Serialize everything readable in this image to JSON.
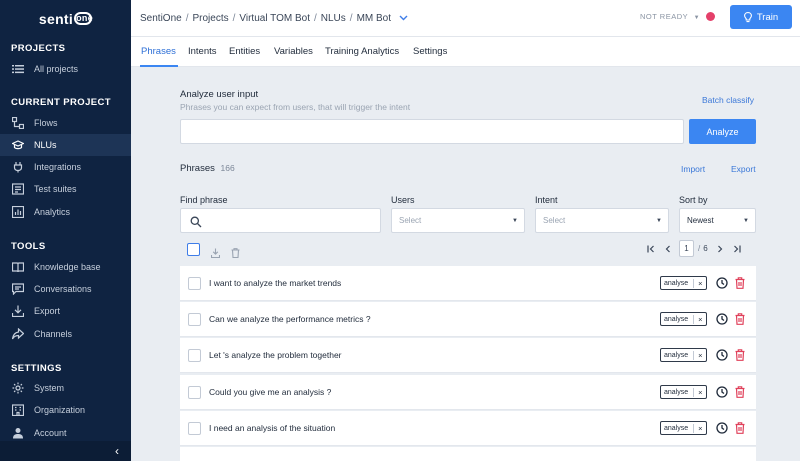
{
  "brand": {
    "name": "senti",
    "bubble": "one"
  },
  "sidebar": {
    "sections": [
      {
        "title": "PROJECTS"
      },
      {
        "title": "CURRENT PROJECT"
      },
      {
        "title": "TOOLS"
      },
      {
        "title": "SETTINGS"
      }
    ],
    "items": [
      {
        "label": "All projects",
        "icon": "list-icon"
      },
      {
        "label": "Flows",
        "icon": "flows-icon"
      },
      {
        "label": "NLUs",
        "icon": "graduation-cap-icon"
      },
      {
        "label": "Integrations",
        "icon": "plug-icon"
      },
      {
        "label": "Test suites",
        "icon": "test-suites-icon"
      },
      {
        "label": "Analytics",
        "icon": "bar-chart-icon"
      },
      {
        "label": "Knowledge base",
        "icon": "book-icon"
      },
      {
        "label": "Conversations",
        "icon": "chat-icon"
      },
      {
        "label": "Export",
        "icon": "download-icon"
      },
      {
        "label": "Channels",
        "icon": "share-icon"
      },
      {
        "label": "System",
        "icon": "gear-icon"
      },
      {
        "label": "Organization",
        "icon": "building-icon"
      },
      {
        "label": "Account",
        "icon": "user-icon"
      }
    ],
    "collapse_glyph": "‹"
  },
  "topbar": {
    "breadcrumb": [
      "SentiOne",
      "Projects",
      "Virtual TOM Bot",
      "NLUs",
      "MM Bot"
    ],
    "separator": "/",
    "status": "NOT READY",
    "train_label": "Train"
  },
  "tabs": [
    "Phrases",
    "Intents",
    "Entities",
    "Variables",
    "Training Analytics",
    "Settings"
  ],
  "analyze": {
    "title": "Analyze user input",
    "subtitle": "Phrases you can expect from users, that will trigger the intent",
    "batch_label": "Batch classify",
    "input_value": "",
    "button_label": "Analyze"
  },
  "phrases": {
    "title": "Phrases",
    "count": "166",
    "import_label": "Import",
    "export_label": "Export"
  },
  "filters": {
    "find_label": "Find phrase",
    "find_value": "",
    "users_label": "Users",
    "users_placeholder": "Select",
    "intent_label": "Intent",
    "intent_placeholder": "Select",
    "sort_label": "Sort by",
    "sort_value": "Newest"
  },
  "pagination": {
    "current": "1",
    "separator": "/",
    "total": "6"
  },
  "rows": [
    {
      "text": "I want to analyze the market trends",
      "tag": "analyse"
    },
    {
      "text": "Can we analyze the performance metrics ?",
      "tag": "analyse"
    },
    {
      "text": "Let 's analyze the problem together",
      "tag": "analyse"
    },
    {
      "text": "Could you give me an analysis ?",
      "tag": "analyse"
    },
    {
      "text": "I need an analysis of the situation",
      "tag": "analyse"
    }
  ],
  "colors": {
    "sidebar": "#0f2341",
    "accent": "#3b86f2",
    "status_dot": "#e4406a",
    "delete": "#e0405a"
  }
}
